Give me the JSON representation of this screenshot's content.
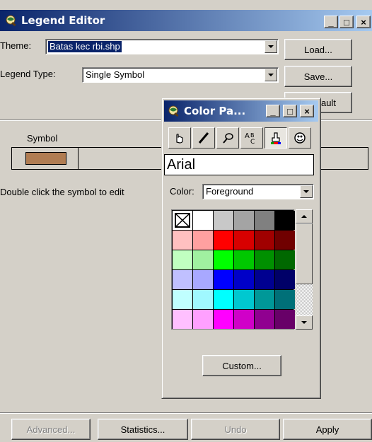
{
  "window": {
    "title": "Legend Editor",
    "controls": [
      "_",
      "□",
      "×"
    ]
  },
  "theme": {
    "label": "Theme:",
    "value": "Batas kec rbi.shp"
  },
  "legend_type": {
    "label": "Legend Type:",
    "value": "Single Symbol"
  },
  "buttons": {
    "load": "Load...",
    "save": "Save...",
    "default_partial": "fault",
    "advanced": "Advanced...",
    "statistics": "Statistics...",
    "undo": "Undo",
    "apply": "Apply"
  },
  "symbol_table": {
    "header": "Symbol",
    "swatch_color": "#b07c52"
  },
  "hint": "Double click the symbol to edit",
  "palette": {
    "title": "Color Pa...",
    "controls": [
      "_",
      "□",
      "×"
    ],
    "tools": [
      "pointer-icon",
      "pen-icon",
      "brush-icon",
      "font-icon",
      "paint-bucket-icon",
      "palette-icon"
    ],
    "font_name": "Arial",
    "color_label": "Color:",
    "color_value": "Foreground",
    "custom_button": "Custom...",
    "colors": [
      [
        "transparent",
        "#ffffff",
        "#c8c8c8",
        "#a4a4a4",
        "#808080",
        "#000000"
      ],
      [
        "#ffc0c0",
        "#ffa0a0",
        "#ff0000",
        "#d80000",
        "#a00000",
        "#700000"
      ],
      [
        "#c0ffc0",
        "#a0f0a0",
        "#00ff00",
        "#00c800",
        "#009000",
        "#006800"
      ],
      [
        "#c0c0ff",
        "#a8a8ff",
        "#0000ff",
        "#0000c8",
        "#000090",
        "#000068"
      ],
      [
        "#c0ffff",
        "#a0f8ff",
        "#00ffff",
        "#00c8d0",
        "#009898",
        "#007078"
      ],
      [
        "#ffc0ff",
        "#ffa0ff",
        "#ff00ff",
        "#d000c8",
        "#900090",
        "#680068"
      ]
    ]
  }
}
